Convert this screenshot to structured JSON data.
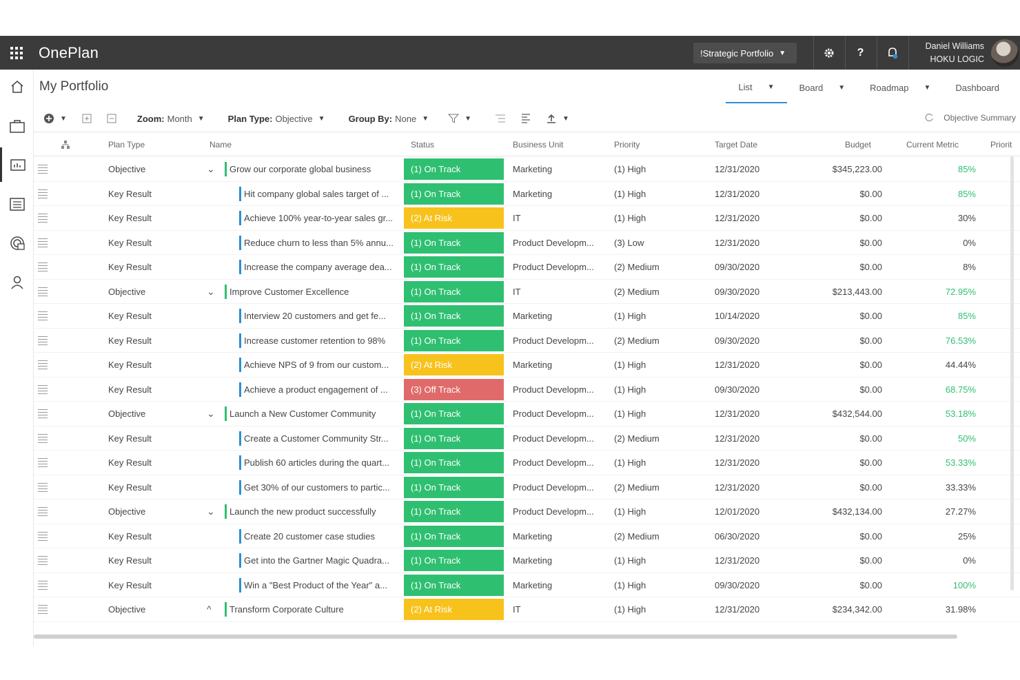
{
  "topbar": {
    "brand": "OnePlan",
    "portfolio_selector": "!Strategic Portfolio",
    "user_name": "Daniel Williams",
    "user_org": "HOKU LOGIC",
    "icons": [
      "waffle-icon",
      "gear-icon",
      "help-icon",
      "notification-bell-icon",
      "avatar"
    ]
  },
  "sidebar": {
    "icons": [
      "home-icon",
      "briefcase-icon",
      "portfolio-chart-icon",
      "calendar-list-icon",
      "resource-icon",
      "person-icon"
    ],
    "active_index": 2
  },
  "header": {
    "title": "My Portfolio",
    "views": [
      {
        "label": "List",
        "active": true
      },
      {
        "label": "Board",
        "active": false
      },
      {
        "label": "Roadmap",
        "active": false
      },
      {
        "label": "Dashboard",
        "active": false
      }
    ]
  },
  "toolbar": {
    "zoom_label": "Zoom:",
    "zoom_value": "Month",
    "plan_type_label": "Plan Type:",
    "plan_type_value": "Objective",
    "group_by_label": "Group By:",
    "group_by_value": "None",
    "objective_summary": "Objective Summary"
  },
  "columns": [
    "Plan Type",
    "Name",
    "Status",
    "Business Unit",
    "Priority",
    "Target Date",
    "Budget",
    "Current Metric",
    "Priorit"
  ],
  "rows": [
    {
      "type": "Objective",
      "name": "Grow our corporate global business",
      "status": "(1) On Track",
      "st": "ok",
      "unit": "Marketing",
      "priority": "(1) High",
      "date": "12/31/2020",
      "budget": "$345,223.00",
      "metric": "85%",
      "green": true,
      "obj": true,
      "chev": "⌄"
    },
    {
      "type": "Key Result",
      "name": "Hit company global sales target of ...",
      "status": "(1) On Track",
      "st": "ok",
      "unit": "Marketing",
      "priority": "(1) High",
      "date": "12/31/2020",
      "budget": "$0.00",
      "metric": "85%",
      "green": true
    },
    {
      "type": "Key Result",
      "name": "Achieve 100% year-to-year sales gr...",
      "status": "(2) At Risk",
      "st": "risk",
      "unit": "IT",
      "priority": "(1) High",
      "date": "12/31/2020",
      "budget": "$0.00",
      "metric": "30%",
      "green": false
    },
    {
      "type": "Key Result",
      "name": "Reduce churn to less than 5% annu...",
      "status": "(1) On Track",
      "st": "ok",
      "unit": "Product Developm...",
      "priority": "(3) Low",
      "date": "12/31/2020",
      "budget": "$0.00",
      "metric": "0%",
      "green": false
    },
    {
      "type": "Key Result",
      "name": "Increase the company average dea...",
      "status": "(1) On Track",
      "st": "ok",
      "unit": "Product Developm...",
      "priority": "(2) Medium",
      "date": "09/30/2020",
      "budget": "$0.00",
      "metric": "8%",
      "green": false
    },
    {
      "type": "Objective",
      "name": "Improve Customer Excellence",
      "status": "(1) On Track",
      "st": "ok",
      "unit": "IT",
      "priority": "(2) Medium",
      "date": "09/30/2020",
      "budget": "$213,443.00",
      "metric": "72.95%",
      "green": true,
      "obj": true,
      "chev": "⌄"
    },
    {
      "type": "Key Result",
      "name": "Interview 20 customers and get fe...",
      "status": "(1) On Track",
      "st": "ok",
      "unit": "Marketing",
      "priority": "(1) High",
      "date": "10/14/2020",
      "budget": "$0.00",
      "metric": "85%",
      "green": true
    },
    {
      "type": "Key Result",
      "name": "Increase customer retention to 98%",
      "status": "(1) On Track",
      "st": "ok",
      "unit": "Product Developm...",
      "priority": "(2) Medium",
      "date": "09/30/2020",
      "budget": "$0.00",
      "metric": "76.53%",
      "green": true
    },
    {
      "type": "Key Result",
      "name": "Achieve NPS of 9 from our custom...",
      "status": "(2) At Risk",
      "st": "risk",
      "unit": "Marketing",
      "priority": "(1) High",
      "date": "12/31/2020",
      "budget": "$0.00",
      "metric": "44.44%",
      "green": false
    },
    {
      "type": "Key Result",
      "name": "Achieve a product engagement of ...",
      "status": "(3) Off Track",
      "st": "off",
      "unit": "Product Developm...",
      "priority": "(1) High",
      "date": "09/30/2020",
      "budget": "$0.00",
      "metric": "68.75%",
      "green": true
    },
    {
      "type": "Objective",
      "name": "Launch a New Customer Community",
      "status": "(1) On Track",
      "st": "ok",
      "unit": "Product Developm...",
      "priority": "(1) High",
      "date": "12/31/2020",
      "budget": "$432,544.00",
      "metric": "53.18%",
      "green": true,
      "obj": true,
      "chev": "⌄"
    },
    {
      "type": "Key Result",
      "name": "Create a Customer Community Str...",
      "status": "(1) On Track",
      "st": "ok",
      "unit": "Product Developm...",
      "priority": "(2) Medium",
      "date": "12/31/2020",
      "budget": "$0.00",
      "metric": "50%",
      "green": true
    },
    {
      "type": "Key Result",
      "name": "Publish 60 articles during the quart...",
      "status": "(1) On Track",
      "st": "ok",
      "unit": "Product Developm...",
      "priority": "(1) High",
      "date": "12/31/2020",
      "budget": "$0.00",
      "metric": "53.33%",
      "green": true
    },
    {
      "type": "Key Result",
      "name": "Get 30% of our customers to partic...",
      "status": "(1) On Track",
      "st": "ok",
      "unit": "Product Developm...",
      "priority": "(2) Medium",
      "date": "12/31/2020",
      "budget": "$0.00",
      "metric": "33.33%",
      "green": false
    },
    {
      "type": "Objective",
      "name": "Launch the new product successfully",
      "status": "(1) On Track",
      "st": "ok",
      "unit": "Product Developm...",
      "priority": "(1) High",
      "date": "12/01/2020",
      "budget": "$432,134.00",
      "metric": "27.27%",
      "green": false,
      "obj": true,
      "chev": "⌄"
    },
    {
      "type": "Key Result",
      "name": "Create 20 customer case studies",
      "status": "(1) On Track",
      "st": "ok",
      "unit": "Marketing",
      "priority": "(2) Medium",
      "date": "06/30/2020",
      "budget": "$0.00",
      "metric": "25%",
      "green": false
    },
    {
      "type": "Key Result",
      "name": "Get into the Gartner Magic Quadra...",
      "status": "(1) On Track",
      "st": "ok",
      "unit": "Marketing",
      "priority": "(1) High",
      "date": "12/31/2020",
      "budget": "$0.00",
      "metric": "0%",
      "green": false
    },
    {
      "type": "Key Result",
      "name": "Win a \"Best Product of the Year\" a...",
      "status": "(1) On Track",
      "st": "ok",
      "unit": "Marketing",
      "priority": "(1) High",
      "date": "09/30/2020",
      "budget": "$0.00",
      "metric": "100%",
      "green": true
    },
    {
      "type": "Objective",
      "name": "Transform Corporate Culture",
      "status": "(2) At Risk",
      "st": "risk",
      "unit": "IT",
      "priority": "(1) High",
      "date": "12/31/2020",
      "budget": "$234,342.00",
      "metric": "31.98%",
      "green": false,
      "obj": true,
      "chev": "^"
    }
  ]
}
